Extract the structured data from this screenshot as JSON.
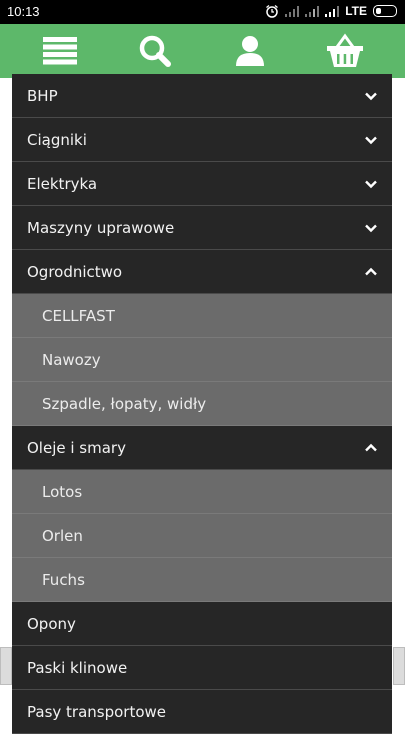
{
  "status_bar": {
    "time": "10:13",
    "network": "LTE",
    "icons": [
      "alarm-icon",
      "signal-icon",
      "signal-icon",
      "signal-icon",
      "battery-icon"
    ]
  },
  "toolbar": {
    "color": "#5db86a",
    "buttons": [
      "menu-icon",
      "search-icon",
      "user-icon",
      "basket-icon"
    ]
  },
  "menu": {
    "items": [
      {
        "label": "BHP",
        "state": "collapsed"
      },
      {
        "label": "Ciągniki",
        "state": "collapsed"
      },
      {
        "label": "Elektryka",
        "state": "collapsed"
      },
      {
        "label": "Maszyny uprawowe",
        "state": "collapsed"
      },
      {
        "label": "Ogrodnictwo",
        "state": "expanded",
        "children": [
          {
            "label": "CELLFAST"
          },
          {
            "label": "Nawozy"
          },
          {
            "label": "Szpadle, łopaty, widły"
          }
        ]
      },
      {
        "label": "Oleje i smary",
        "state": "expanded",
        "children": [
          {
            "label": "Lotos"
          },
          {
            "label": "Orlen"
          },
          {
            "label": "Fuchs"
          }
        ]
      },
      {
        "label": "Opony",
        "state": "none"
      },
      {
        "label": "Paski klinowe",
        "state": "none"
      },
      {
        "label": "Pasy transportowe",
        "state": "none"
      }
    ]
  }
}
